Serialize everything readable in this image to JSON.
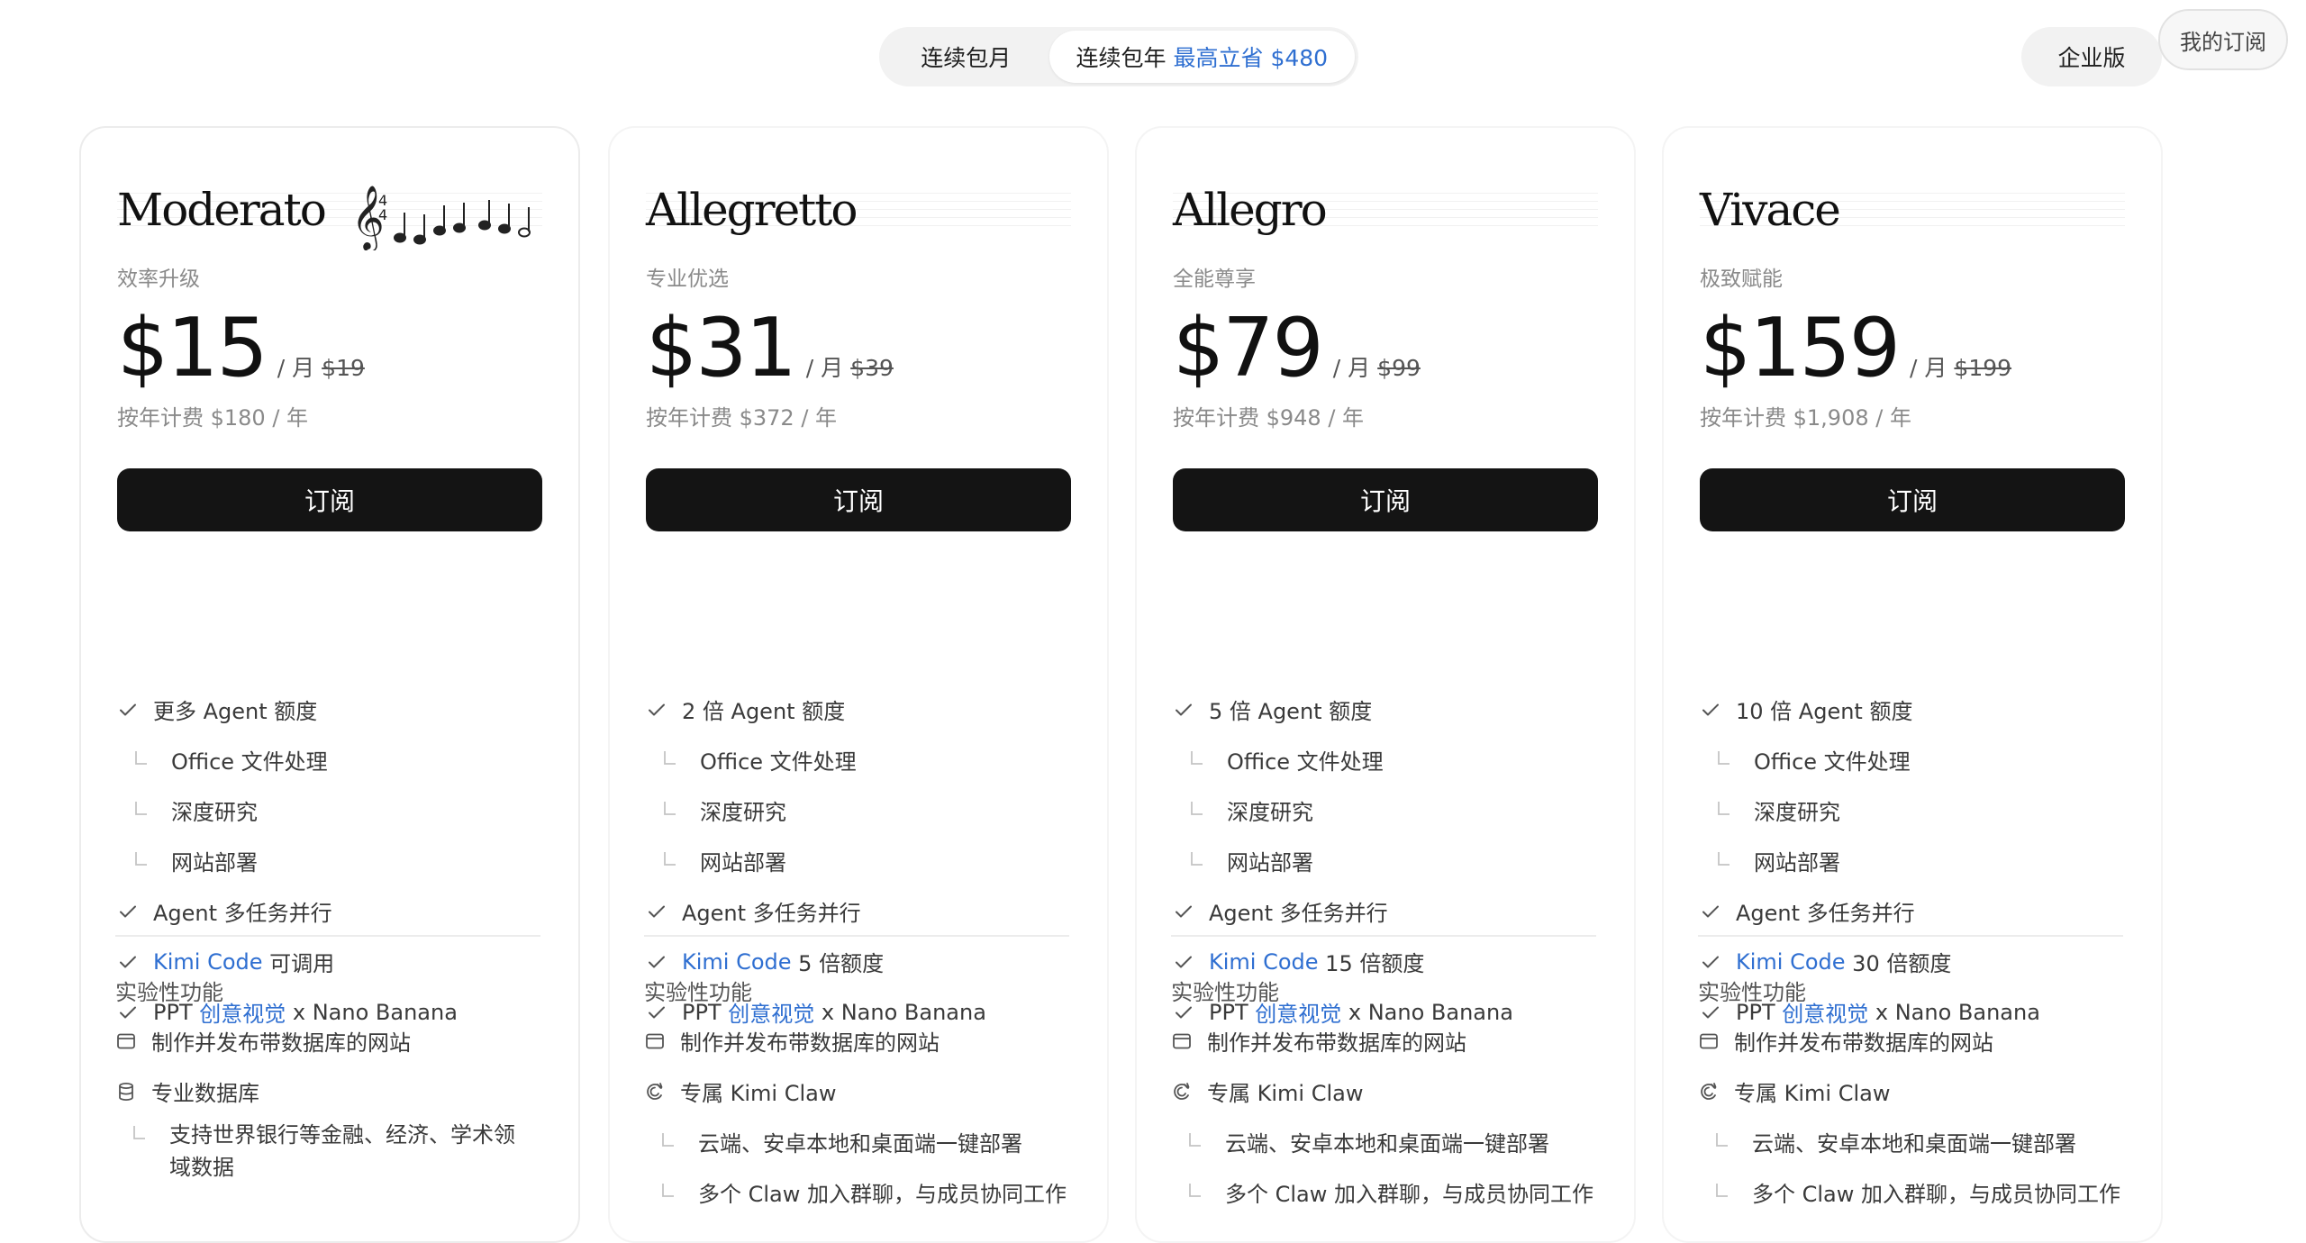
{
  "billing_toggle": {
    "monthly": "连续包月",
    "yearly": "连续包年",
    "yearly_save": "最高立省 $480"
  },
  "enterprise": "企业版",
  "my_subscription": "我的订阅",
  "colors": {
    "accent": "#2f6fd1",
    "button": "#141414"
  },
  "plans": [
    {
      "name": "Moderato",
      "tagline": "效率升级",
      "price": "$15",
      "per": "/ 月",
      "original": "$19",
      "yearly": "按年计费 $180 / 年",
      "button": "订阅",
      "features": {
        "agent": "更多 Agent 额度",
        "office": "Office 文件处理",
        "research": "深度研究",
        "deploy": "网站部署",
        "multitask": "Agent 多任务并行",
        "kimi_code": "Kimi Code",
        "kimi_code_suffix": "可调用",
        "ppt_prefix": "PPT",
        "ppt_link": "创意视觉",
        "ppt_suffix": "x Nano Banana"
      },
      "experimental_title": "实验性功能",
      "experimental": [
        "制作并发布带数据库的网站",
        "专业数据库",
        "支持世界银行等金融、经济、学术领域数据"
      ]
    },
    {
      "name": "Allegretto",
      "tagline": "专业优选",
      "price": "$31",
      "per": "/ 月",
      "original": "$39",
      "yearly": "按年计费 $372 / 年",
      "button": "订阅",
      "features": {
        "agent": "2 倍 Agent 额度",
        "office": "Office 文件处理",
        "research": "深度研究",
        "deploy": "网站部署",
        "multitask": "Agent 多任务并行",
        "kimi_code": "Kimi Code",
        "kimi_code_suffix": "5 倍额度",
        "ppt_prefix": "PPT",
        "ppt_link": "创意视觉",
        "ppt_suffix": "x Nano Banana"
      },
      "experimental_title": "实验性功能",
      "experimental": [
        "制作并发布带数据库的网站",
        "专属 Kimi Claw",
        "云端、安卓本地和桌面端一键部署",
        "多个 Claw 加入群聊，与成员协同工作"
      ]
    },
    {
      "name": "Allegro",
      "tagline": "全能尊享",
      "price": "$79",
      "per": "/ 月",
      "original": "$99",
      "yearly": "按年计费 $948 / 年",
      "button": "订阅",
      "features": {
        "agent": "5 倍 Agent 额度",
        "office": "Office 文件处理",
        "research": "深度研究",
        "deploy": "网站部署",
        "multitask": "Agent 多任务并行",
        "kimi_code": "Kimi Code",
        "kimi_code_suffix": "15 倍额度",
        "ppt_prefix": "PPT",
        "ppt_link": "创意视觉",
        "ppt_suffix": "x Nano Banana"
      },
      "experimental_title": "实验性功能",
      "experimental": [
        "制作并发布带数据库的网站",
        "专属 Kimi Claw",
        "云端、安卓本地和桌面端一键部署",
        "多个 Claw 加入群聊，与成员协同工作"
      ]
    },
    {
      "name": "Vivace",
      "tagline": "极致赋能",
      "price": "$159",
      "per": "/ 月",
      "original": "$199",
      "yearly": "按年计费 $1,908 / 年",
      "button": "订阅",
      "features": {
        "agent": "10 倍 Agent 额度",
        "office": "Office 文件处理",
        "research": "深度研究",
        "deploy": "网站部署",
        "multitask": "Agent 多任务并行",
        "kimi_code": "Kimi Code",
        "kimi_code_suffix": "30 倍额度",
        "ppt_prefix": "PPT",
        "ppt_link": "创意视觉",
        "ppt_suffix": "x Nano Banana"
      },
      "experimental_title": "实验性功能",
      "experimental": [
        "制作并发布带数据库的网站",
        "专属 Kimi Claw",
        "云端、安卓本地和桌面端一键部署",
        "多个 Claw 加入群聊，与成员协同工作"
      ]
    }
  ]
}
